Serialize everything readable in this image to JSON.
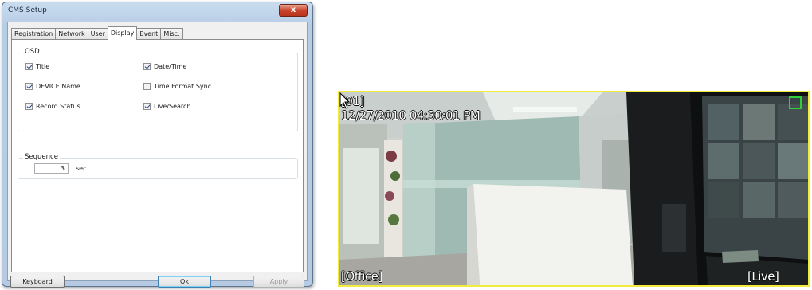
{
  "window": {
    "title": "CMS Setup",
    "close_label": "x"
  },
  "tabs": [
    {
      "label": "Registration",
      "active": false
    },
    {
      "label": "Network",
      "active": false
    },
    {
      "label": "User",
      "active": false
    },
    {
      "label": "Display",
      "active": true
    },
    {
      "label": "Event",
      "active": false
    },
    {
      "label": "Misc.",
      "active": false
    }
  ],
  "osd": {
    "label": "OSD",
    "options": [
      {
        "label": "Title",
        "checked": true
      },
      {
        "label": "Date/Time",
        "checked": true
      },
      {
        "label": "DEVICE Name",
        "checked": true
      },
      {
        "label": "Time Format Sync",
        "checked": false
      },
      {
        "label": "Record Status",
        "checked": true
      },
      {
        "label": "Live/Search",
        "checked": true
      }
    ]
  },
  "sequence": {
    "label": "Sequence",
    "value": "3",
    "unit": "sec"
  },
  "buttons": {
    "keyboard": "Keyboard",
    "ok": "Ok",
    "apply": "Apply"
  },
  "camera": {
    "channel": "[01]",
    "datetime": "12/27/2010 04:30:01 PM",
    "name": "[Office]",
    "mode": "[Live]",
    "border_color": "#f3ec3a"
  }
}
